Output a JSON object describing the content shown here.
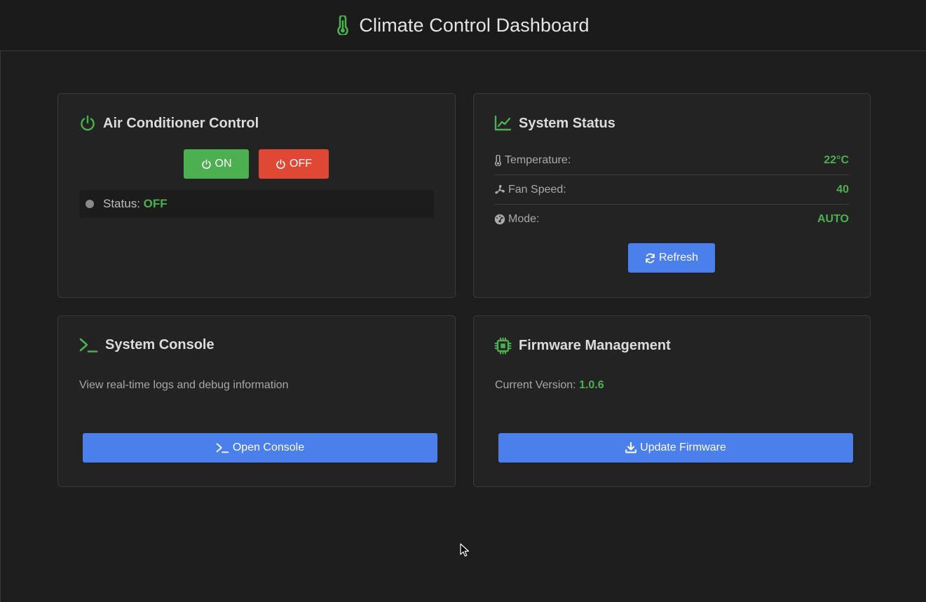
{
  "header": {
    "title": "Climate Control Dashboard",
    "icon": "thermometer-icon"
  },
  "colors": {
    "accent_green": "#4caf50",
    "danger_red": "#e04836",
    "primary_blue": "#4a7fec",
    "background": "#1e1e1e",
    "card": "#232323"
  },
  "ac_control": {
    "title": "Air Conditioner Control",
    "icon": "power-icon",
    "on_label": "ON",
    "off_label": "OFF",
    "status_label": "Status:",
    "status_value": "OFF"
  },
  "system_status": {
    "title": "System Status",
    "icon": "chart-line-icon",
    "rows": [
      {
        "label": "Temperature:",
        "value": "22°C",
        "icon": "thermometer-icon"
      },
      {
        "label": "Fan Speed:",
        "value": "40",
        "icon": "fan-icon"
      },
      {
        "label": "Mode:",
        "value": "AUTO",
        "icon": "gauge-icon"
      }
    ],
    "refresh_label": "Refresh"
  },
  "console": {
    "title": "System Console",
    "icon": "terminal-icon",
    "description": "View real-time logs and debug information",
    "button_label": "Open Console"
  },
  "firmware": {
    "title": "Firmware Management",
    "icon": "chip-icon",
    "version_label": "Current Version:",
    "version_value": "1.0.6",
    "button_label": "Update Firmware"
  }
}
